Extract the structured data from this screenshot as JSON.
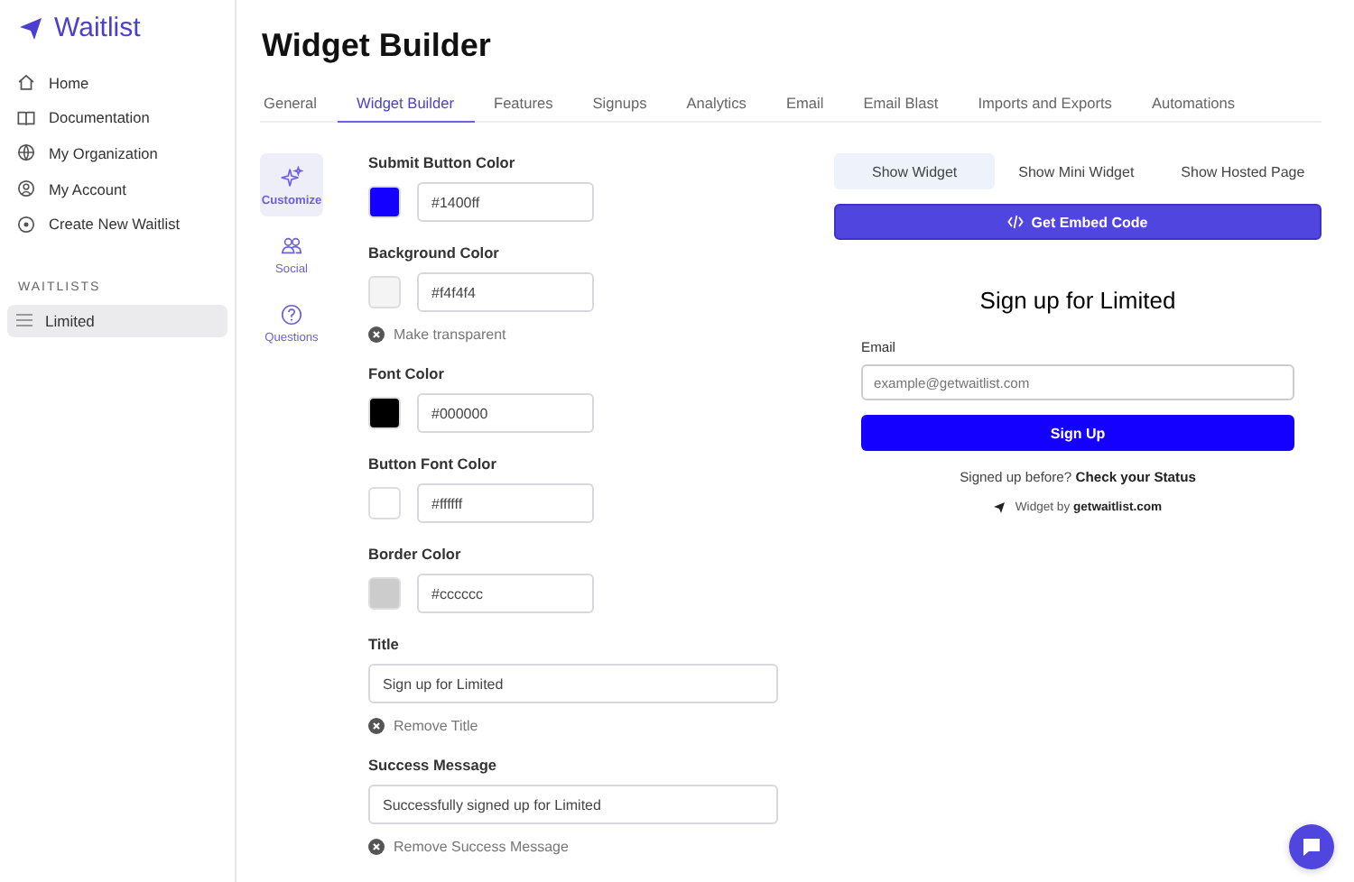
{
  "app": {
    "name": "Waitlist"
  },
  "nav": [
    {
      "label": "Home"
    },
    {
      "label": "Documentation"
    },
    {
      "label": "My Organization"
    },
    {
      "label": "My Account"
    },
    {
      "label": "Create New Waitlist"
    }
  ],
  "waitlists": {
    "heading": "WAITLISTS",
    "items": [
      {
        "label": "Limited",
        "selected": true
      }
    ]
  },
  "page": {
    "title": "Widget Builder"
  },
  "tabs": [
    {
      "label": "General",
      "selected": false
    },
    {
      "label": "Widget Builder",
      "selected": true
    },
    {
      "label": "Features",
      "selected": false
    },
    {
      "label": "Signups",
      "selected": false
    },
    {
      "label": "Analytics",
      "selected": false
    },
    {
      "label": "Email",
      "selected": false
    },
    {
      "label": "Email Blast",
      "selected": false
    },
    {
      "label": "Imports and Exports",
      "selected": false
    },
    {
      "label": "Automations",
      "selected": false
    }
  ],
  "sections": [
    {
      "label": "Customize",
      "selected": true
    },
    {
      "label": "Social",
      "selected": false
    },
    {
      "label": "Questions",
      "selected": false
    }
  ],
  "fields": [
    {
      "kind": "color",
      "label": "Submit Button Color",
      "color": "#1400ff",
      "value": "#1400ff"
    },
    {
      "kind": "color",
      "label": "Background Color",
      "color": "#f4f4f4",
      "value": "#f4f4f4",
      "remove": "Make transparent"
    },
    {
      "kind": "color",
      "label": "Font Color",
      "color": "#000000",
      "value": "#000000"
    },
    {
      "kind": "color",
      "label": "Button Font Color",
      "color": "#ffffff",
      "value": "#ffffff"
    },
    {
      "kind": "color",
      "label": "Border Color",
      "color": "#cccccc",
      "value": "#cccccc"
    },
    {
      "kind": "text",
      "label": "Title",
      "value": "Sign up for Limited",
      "remove": "Remove Title"
    },
    {
      "kind": "text",
      "label": "Success Message",
      "value": "Successfully signed up for Limited",
      "remove": "Remove Success Message"
    }
  ],
  "preview": {
    "views": [
      {
        "label": "Show Widget",
        "selected": true
      },
      {
        "label": "Show Mini Widget",
        "selected": false
      },
      {
        "label": "Show Hosted Page",
        "selected": false
      }
    ],
    "embed_button": "Get Embed Code",
    "widget": {
      "title": "Sign up for Limited",
      "email_label": "Email",
      "email_placeholder": "example@getwaitlist.com",
      "submit": "Sign Up",
      "status_text": "Signed up before? **Check your Status**",
      "footer": "Widget by **getwaitlist.com**"
    }
  }
}
